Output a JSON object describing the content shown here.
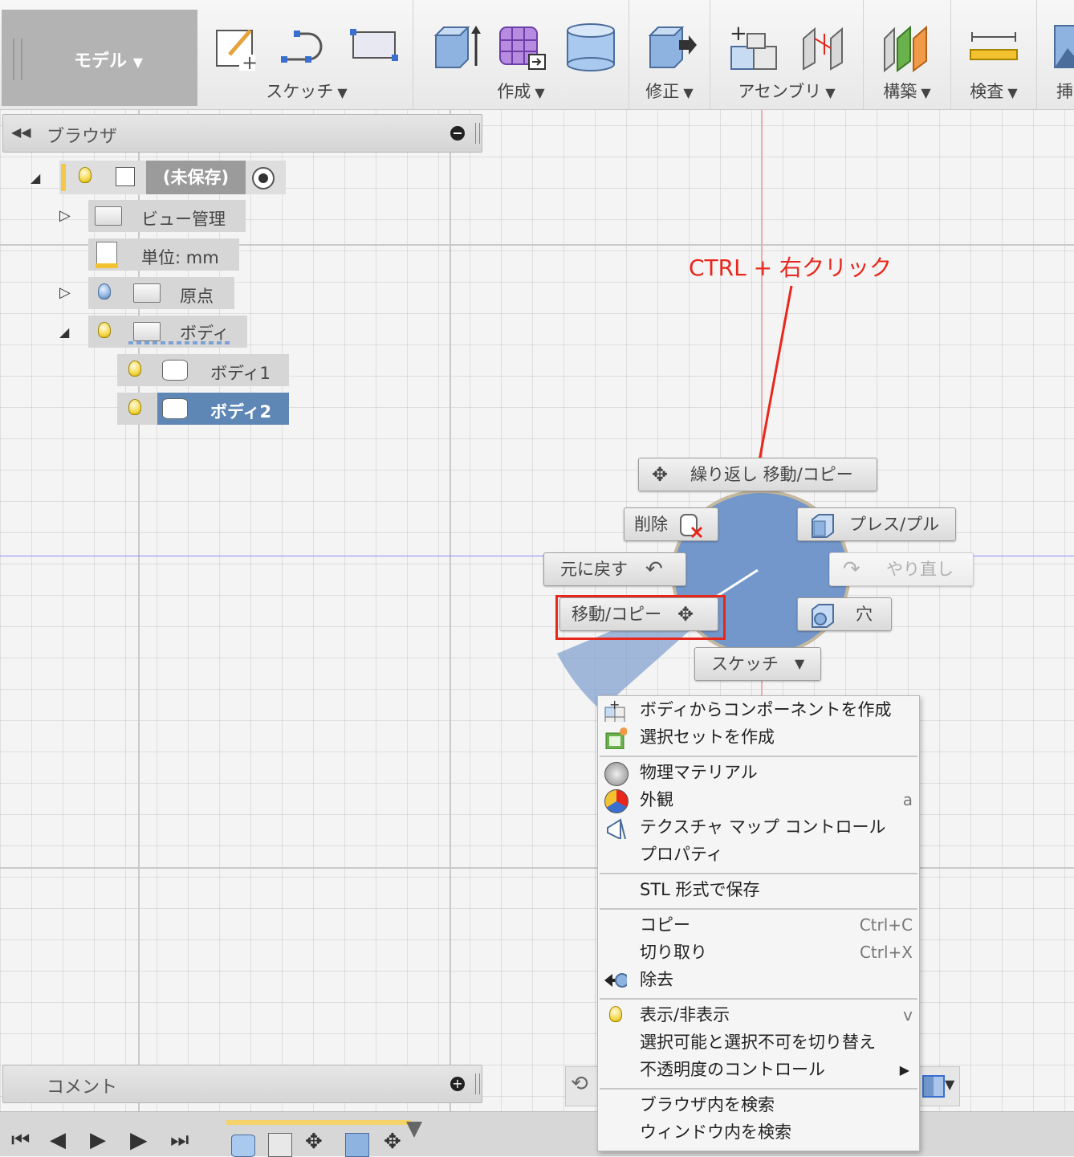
{
  "toolbar": {
    "workspace": "モデル",
    "groups": {
      "sketch": "スケッチ",
      "create": "作成",
      "modify": "修正",
      "assemble": "アセンブリ",
      "construct": "構築",
      "inspect": "検査",
      "insert": "挿"
    }
  },
  "browser": {
    "title": "ブラウザ",
    "root": "(未保存)",
    "items": {
      "view_management": "ビュー管理",
      "units": "単位: mm",
      "origin": "原点",
      "bodies": "ボディ",
      "body1": "ボディ1",
      "body2": "ボディ2"
    }
  },
  "comments": {
    "title": "コメント"
  },
  "annotation": {
    "text": "CTRL + 右クリック",
    "color": "#e8271c"
  },
  "marking_menu": {
    "repeat": "繰り返し 移動/コピー",
    "delete": "削除",
    "press_pull": "プレス/プル",
    "undo": "元に戻す",
    "redo": "やり直し",
    "move_copy": "移動/コピー",
    "hole": "穴",
    "sketch": "スケッチ"
  },
  "context_menu": {
    "create_component": "ボディからコンポーネントを作成",
    "create_selection_set": "選択セットを作成",
    "physical_material": "物理マテリアル",
    "appearance": "外観",
    "appearance_shortcut": "a",
    "texture_map": "テクスチャ マップ コントロール",
    "properties": "プロパティ",
    "save_stl": "STL 形式で保存",
    "copy": "コピー",
    "copy_shortcut": "Ctrl+C",
    "cut": "切り取り",
    "cut_shortcut": "Ctrl+X",
    "remove": "除去",
    "show_hide": "表示/非表示",
    "show_hide_shortcut": "v",
    "toggle_selectable": "選択可能と選択不可を切り替え",
    "opacity_control": "不透明度のコントロール",
    "find_in_browser": "ブラウザ内を検索",
    "find_in_window": "ウィンドウ内を検索"
  },
  "colors": {
    "accent_blue": "#5f87b6",
    "highlight_red": "#e8271c",
    "selection_blue": "#7095c4"
  }
}
